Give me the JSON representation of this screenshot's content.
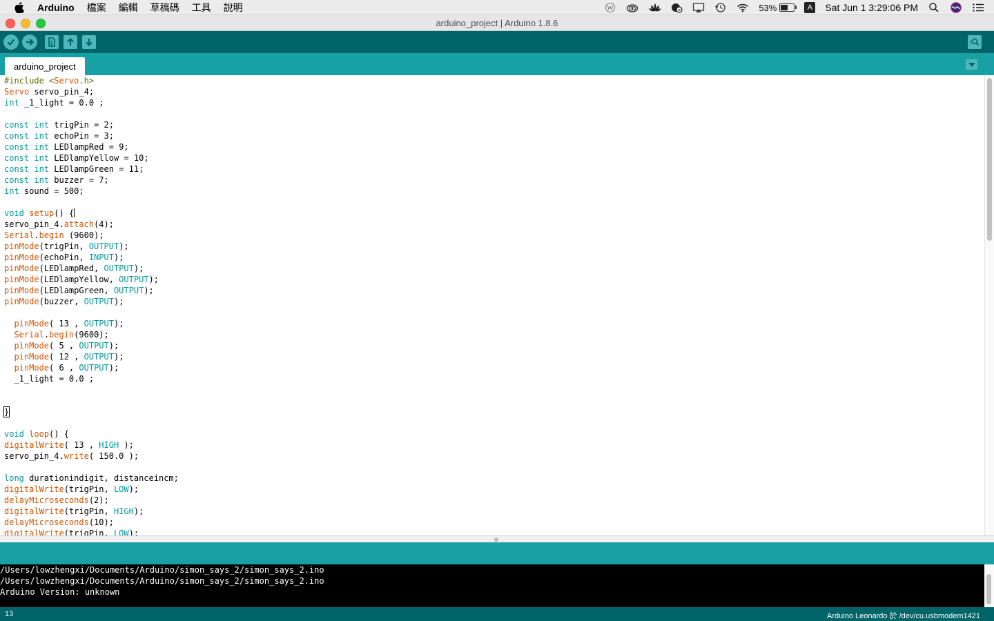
{
  "menubar": {
    "app_name": "Arduino",
    "menus": [
      "檔案",
      "編輯",
      "草稿碼",
      "工具",
      "說明"
    ],
    "battery_percent": "53%",
    "battery_level": 0.53,
    "input_badge": "A",
    "clock": "Sat Jun 1  3:29:06 PM"
  },
  "window": {
    "title": "arduino_project | Arduino 1.8.6"
  },
  "tabs": {
    "active": "arduino_project"
  },
  "editor": {
    "lines": [
      [
        [
          "pre",
          "#include <"
        ],
        [
          "fn",
          "Servo"
        ],
        [
          "pre",
          ".h>"
        ]
      ],
      [
        [
          "fn",
          "Servo"
        ],
        [
          "t",
          " servo_pin_4;"
        ]
      ],
      [
        [
          "kw",
          "int"
        ],
        [
          "t",
          " _1_light = 0.0 ;"
        ]
      ],
      [],
      [
        [
          "kw",
          "const"
        ],
        [
          "t",
          " "
        ],
        [
          "kw",
          "int"
        ],
        [
          "t",
          " trigPin = 2;"
        ]
      ],
      [
        [
          "kw",
          "const"
        ],
        [
          "t",
          " "
        ],
        [
          "kw",
          "int"
        ],
        [
          "t",
          " echoPin = 3;"
        ]
      ],
      [
        [
          "kw",
          "const"
        ],
        [
          "t",
          " "
        ],
        [
          "kw",
          "int"
        ],
        [
          "t",
          " LEDlampRed = 9;"
        ]
      ],
      [
        [
          "kw",
          "const"
        ],
        [
          "t",
          " "
        ],
        [
          "kw",
          "int"
        ],
        [
          "t",
          " LEDlampYellow = 10;"
        ]
      ],
      [
        [
          "kw",
          "const"
        ],
        [
          "t",
          " "
        ],
        [
          "kw",
          "int"
        ],
        [
          "t",
          " LEDlampGreen = 11;"
        ]
      ],
      [
        [
          "kw",
          "const"
        ],
        [
          "t",
          " "
        ],
        [
          "kw",
          "int"
        ],
        [
          "t",
          " buzzer = 7;"
        ]
      ],
      [
        [
          "kw",
          "int"
        ],
        [
          "t",
          " sound = 500;"
        ]
      ],
      [],
      [
        [
          "kw",
          "void"
        ],
        [
          "t",
          " "
        ],
        [
          "fn",
          "setup"
        ],
        [
          "t",
          "() {"
        ],
        [
          "cursor",
          ""
        ]
      ],
      [
        [
          "t",
          "servo_pin_4."
        ],
        [
          "fn",
          "attach"
        ],
        [
          "t",
          "(4);"
        ]
      ],
      [
        [
          "fn",
          "Serial"
        ],
        [
          "t",
          "."
        ],
        [
          "fn",
          "begin"
        ],
        [
          "t",
          " (9600);"
        ]
      ],
      [
        [
          "fn",
          "pinMode"
        ],
        [
          "t",
          "(trigPin, "
        ],
        [
          "cons",
          "OUTPUT"
        ],
        [
          "t",
          ");"
        ]
      ],
      [
        [
          "fn",
          "pinMode"
        ],
        [
          "t",
          "(echoPin, "
        ],
        [
          "cons",
          "INPUT"
        ],
        [
          "t",
          ");"
        ]
      ],
      [
        [
          "fn",
          "pinMode"
        ],
        [
          "t",
          "(LEDlampRed, "
        ],
        [
          "cons",
          "OUTPUT"
        ],
        [
          "t",
          ");"
        ]
      ],
      [
        [
          "fn",
          "pinMode"
        ],
        [
          "t",
          "(LEDlampYellow, "
        ],
        [
          "cons",
          "OUTPUT"
        ],
        [
          "t",
          ");"
        ]
      ],
      [
        [
          "fn",
          "pinMode"
        ],
        [
          "t",
          "(LEDlampGreen, "
        ],
        [
          "cons",
          "OUTPUT"
        ],
        [
          "t",
          ");"
        ]
      ],
      [
        [
          "fn",
          "pinMode"
        ],
        [
          "t",
          "(buzzer, "
        ],
        [
          "cons",
          "OUTPUT"
        ],
        [
          "t",
          ");"
        ]
      ],
      [],
      [
        [
          "t",
          "  "
        ],
        [
          "fn",
          "pinMode"
        ],
        [
          "t",
          "( 13 , "
        ],
        [
          "cons",
          "OUTPUT"
        ],
        [
          "t",
          ");"
        ]
      ],
      [
        [
          "t",
          "  "
        ],
        [
          "fn",
          "Serial"
        ],
        [
          "t",
          "."
        ],
        [
          "fn",
          "begin"
        ],
        [
          "t",
          "(9600);"
        ]
      ],
      [
        [
          "t",
          "  "
        ],
        [
          "fn",
          "pinMode"
        ],
        [
          "t",
          "( 5 , "
        ],
        [
          "cons",
          "OUTPUT"
        ],
        [
          "t",
          ");"
        ]
      ],
      [
        [
          "t",
          "  "
        ],
        [
          "fn",
          "pinMode"
        ],
        [
          "t",
          "( 12 , "
        ],
        [
          "cons",
          "OUTPUT"
        ],
        [
          "t",
          ");"
        ]
      ],
      [
        [
          "t",
          "  "
        ],
        [
          "fn",
          "pinMode"
        ],
        [
          "t",
          "( 6 , "
        ],
        [
          "cons",
          "OUTPUT"
        ],
        [
          "t",
          ");"
        ]
      ],
      [
        [
          "t",
          "  _1_light = 0.0 ;"
        ]
      ],
      [],
      [],
      [
        [
          "box",
          "}"
        ]
      ],
      [],
      [
        [
          "kw",
          "void"
        ],
        [
          "t",
          " "
        ],
        [
          "fn",
          "loop"
        ],
        [
          "t",
          "() {"
        ]
      ],
      [
        [
          "fn",
          "digitalWrite"
        ],
        [
          "t",
          "( 13 , "
        ],
        [
          "cons",
          "HIGH"
        ],
        [
          "t",
          " );"
        ]
      ],
      [
        [
          "t",
          "servo_pin_4."
        ],
        [
          "fn",
          "write"
        ],
        [
          "t",
          "( 150.0 );"
        ]
      ],
      [],
      [
        [
          "kw",
          "long"
        ],
        [
          "t",
          " durationindigit, distanceincm;"
        ]
      ],
      [
        [
          "fn",
          "digitalWrite"
        ],
        [
          "t",
          "(trigPin, "
        ],
        [
          "cons",
          "LOW"
        ],
        [
          "t",
          ");"
        ]
      ],
      [
        [
          "fn",
          "delayMicroseconds"
        ],
        [
          "t",
          "(2);"
        ]
      ],
      [
        [
          "fn",
          "digitalWrite"
        ],
        [
          "t",
          "(trigPin, "
        ],
        [
          "cons",
          "HIGH"
        ],
        [
          "t",
          ");"
        ]
      ],
      [
        [
          "fn",
          "delayMicroseconds"
        ],
        [
          "t",
          "(10);"
        ]
      ],
      [
        [
          "fn",
          "digitalWrite"
        ],
        [
          "t",
          "(trigPin, "
        ],
        [
          "cons",
          "LOW"
        ],
        [
          "t",
          ");"
        ]
      ]
    ]
  },
  "console": {
    "lines": [
      "/Users/lowzhengxi/Documents/Arduino/simon_says_2/simon_says_2.ino",
      "/Users/lowzhengxi/Documents/Arduino/simon_says_2/simon_says_2.ino",
      "Arduino Version: unknown"
    ]
  },
  "status": {
    "line_number": "13",
    "board": "Arduino Leonardo 於 /dev/cu.usbmodem1421"
  },
  "colors": {
    "toolbar": "#006468",
    "tabbar": "#17a1a5",
    "button": "#4db7bb",
    "keyword": "#00979c",
    "function": "#d35400",
    "preprocessor": "#5e6d03"
  },
  "icons": {
    "verify": "check-icon",
    "upload": "arrow-right-icon",
    "new": "file-icon",
    "open": "arrow-up-icon",
    "save": "arrow-down-icon",
    "serial_monitor": "magnifier-icon",
    "tab_menu": "triangle-down-icon"
  }
}
